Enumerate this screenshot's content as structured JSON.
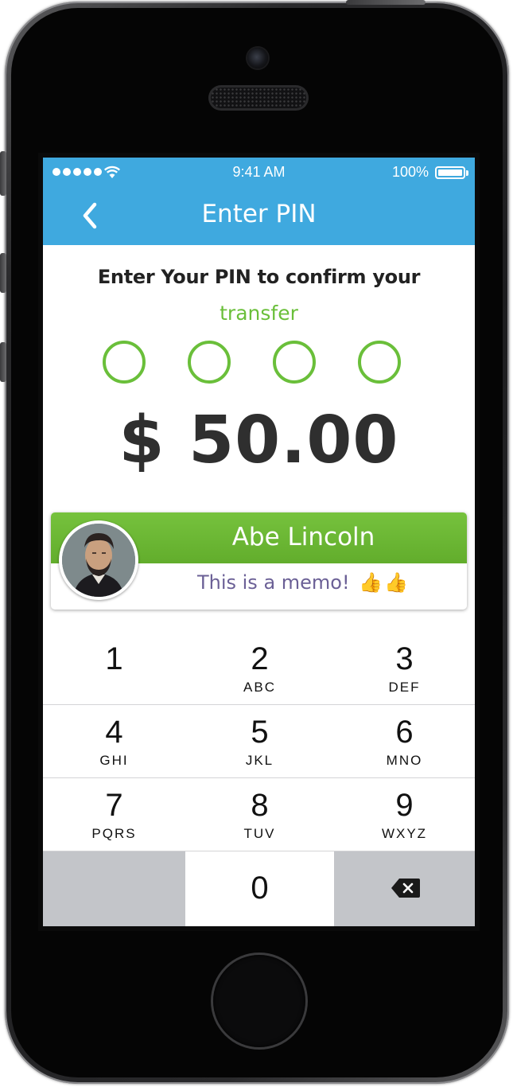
{
  "status_bar": {
    "time": "9:41 AM",
    "battery": "100%"
  },
  "nav": {
    "title": "Enter PIN",
    "back_icon": "chevron-left-icon"
  },
  "prompt": {
    "line1": "Enter Your PIN to confirm your",
    "line2": "transfer"
  },
  "pin": {
    "length": 4,
    "entered": 0
  },
  "amount": "$ 50.00",
  "recipient": {
    "name": "Abe Lincoln",
    "memo": "This is a memo!",
    "memo_emoji": "👍👍"
  },
  "keypad": {
    "keys": [
      {
        "digit": "1",
        "letters": ""
      },
      {
        "digit": "2",
        "letters": "ABC"
      },
      {
        "digit": "3",
        "letters": "DEF"
      },
      {
        "digit": "4",
        "letters": "GHI"
      },
      {
        "digit": "5",
        "letters": "JKL"
      },
      {
        "digit": "6",
        "letters": "MNO"
      },
      {
        "digit": "7",
        "letters": "PQRS"
      },
      {
        "digit": "8",
        "letters": "TUV"
      },
      {
        "digit": "9",
        "letters": "WXYZ"
      },
      {
        "digit": "0",
        "letters": ""
      }
    ],
    "delete_icon": "backspace-icon"
  },
  "colors": {
    "nav_blue": "#3fa9df",
    "accent_green": "#6abf3a",
    "memo_purple": "#6b6096",
    "keypad_gray": "#c3c5c9"
  }
}
